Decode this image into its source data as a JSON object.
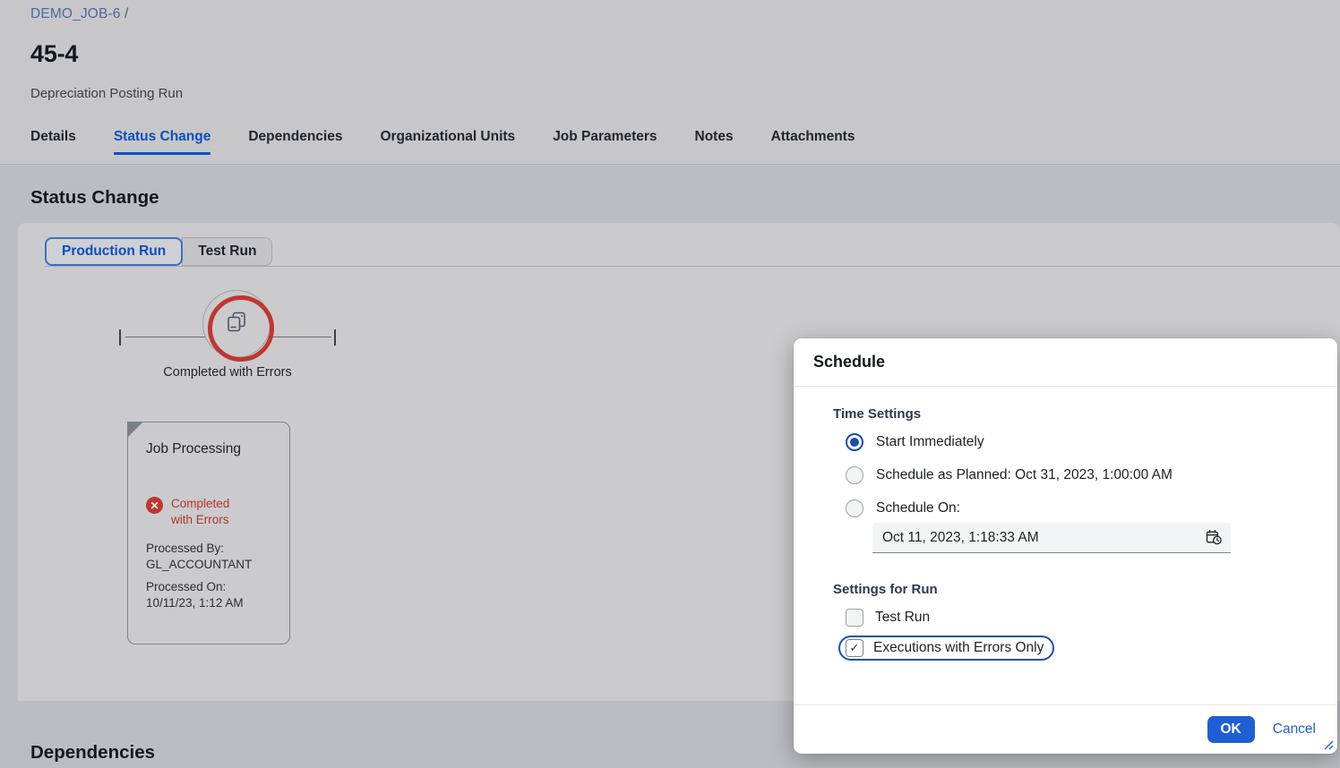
{
  "header": {
    "breadcrumb": {
      "link": "DEMO_JOB-6",
      "separator": "/"
    },
    "title": "45-4",
    "subtitle": "Depreciation Posting Run",
    "tabs": [
      {
        "label": "Details",
        "active": false
      },
      {
        "label": "Status Change",
        "active": true
      },
      {
        "label": "Dependencies",
        "active": false
      },
      {
        "label": "Organizational Units",
        "active": false
      },
      {
        "label": "Job Parameters",
        "active": false
      },
      {
        "label": "Notes",
        "active": false
      },
      {
        "label": "Attachments",
        "active": false
      }
    ]
  },
  "main": {
    "section_title": "Status Change",
    "segmented": {
      "options": [
        {
          "label": "Production Run",
          "selected": true
        },
        {
          "label": "Test Run",
          "selected": false
        }
      ]
    },
    "status_node": {
      "caption": "Completed with Errors",
      "ring_color": "#c0372f",
      "icon": "job-copies-icon"
    },
    "job_card": {
      "title": "Job Processing",
      "status_text": "Completed with Errors",
      "status_color": "#b0332c",
      "processed_by_label": "Processed By:",
      "processed_by_value": "GL_ACCOUNTANT",
      "processed_on_label": "Processed On:",
      "processed_on_value": "10/11/23, 1:12 AM"
    },
    "bottom_section_title": "Dependencies"
  },
  "dialog": {
    "title": "Schedule",
    "time_settings": {
      "label": "Time Settings",
      "options": [
        {
          "label": "Start Immediately",
          "checked": true
        },
        {
          "label": "Schedule as Planned: Oct 31, 2023, 1:00:00 AM",
          "checked": false
        },
        {
          "label": "Schedule On:",
          "checked": false
        }
      ],
      "date_value": "Oct 11, 2023, 1:18:33 AM",
      "date_icon": "calendar-clock-icon"
    },
    "settings_for_run": {
      "label": "Settings for Run",
      "checkboxes": [
        {
          "label": "Test Run",
          "checked": false,
          "focused": false
        },
        {
          "label": "Executions with Errors Only",
          "checked": true,
          "focused": true
        }
      ]
    },
    "footer": {
      "ok_label": "OK",
      "cancel_label": "Cancel",
      "accent_color": "#1f5fd6"
    }
  }
}
